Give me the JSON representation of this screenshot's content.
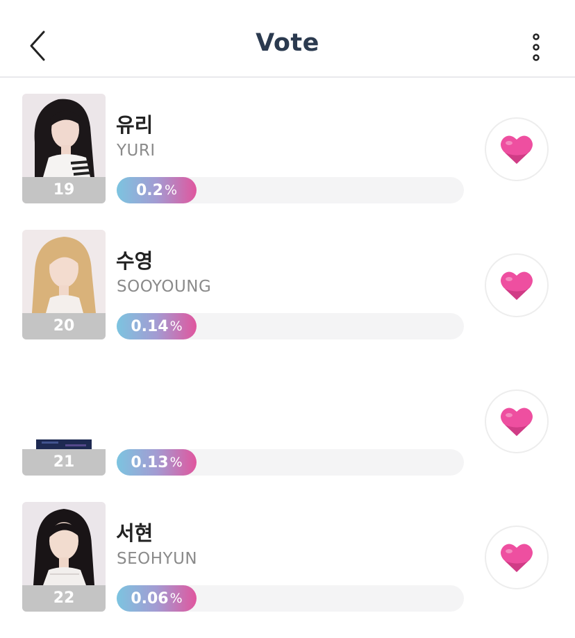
{
  "header": {
    "title": "Vote",
    "back_icon": "chevron-left-icon",
    "more_icon": "more-vertical-icon"
  },
  "colors": {
    "title": "#2b3a4f",
    "heart": "#ee4fa0",
    "bar_gradient": [
      "#7cc4e0",
      "#a39bd2",
      "#e0569e"
    ],
    "rank_bg": "#c4c4c4"
  },
  "candidates": [
    {
      "rank": "19",
      "name_ko": "유리",
      "name_en": "YURI",
      "percent": "0.2",
      "percent_sign": "%",
      "bar_fill_fraction": 0.23
    },
    {
      "rank": "20",
      "name_ko": "수영",
      "name_en": "SOOYOUNG",
      "percent": "0.14",
      "percent_sign": "%",
      "bar_fill_fraction": 0.23
    },
    {
      "rank": "21",
      "name_ko": "",
      "name_en": "",
      "percent": "0.13",
      "percent_sign": "%",
      "bar_fill_fraction": 0.23
    },
    {
      "rank": "22",
      "name_ko": "서현",
      "name_en": "SEOHYUN",
      "percent": "0.06",
      "percent_sign": "%",
      "bar_fill_fraction": 0.23
    }
  ]
}
